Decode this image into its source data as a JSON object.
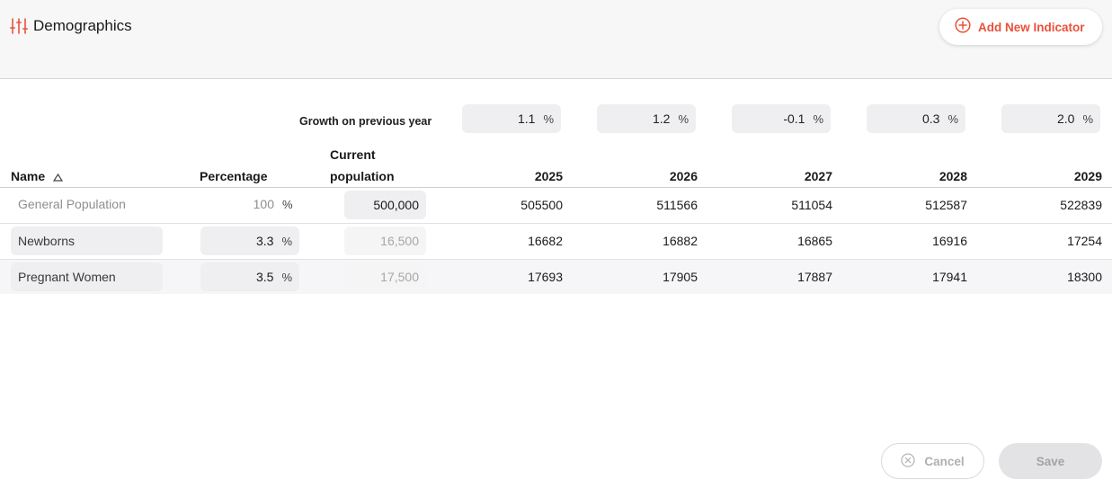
{
  "header": {
    "title": "Demographics",
    "title_icon": "sliders-icon",
    "add_button_label": "Add New Indicator",
    "add_button_icon": "plus-circle-icon",
    "accent_color": "#e8523a"
  },
  "growth": {
    "label": "Growth on previous year",
    "unit": "%",
    "values": [
      "1.1",
      "1.2",
      "-0.1",
      "0.3",
      "2.0"
    ]
  },
  "table": {
    "headers": {
      "name": "Name",
      "percentage": "Percentage",
      "current_population_line1": "Current",
      "current_population_line2": "population",
      "years": [
        "2025",
        "2026",
        "2027",
        "2028",
        "2029"
      ]
    },
    "sort_icon": "sort-ascending-icon",
    "pct_unit": "%",
    "rows": [
      {
        "name": "General Population",
        "percentage": "100",
        "current_population": "500,000",
        "values": [
          "505500",
          "511566",
          "511054",
          "512587",
          "522839"
        ]
      },
      {
        "name": "Newborns",
        "percentage": "3.3",
        "current_population": "16,500",
        "values": [
          "16682",
          "16882",
          "16865",
          "16916",
          "17254"
        ]
      },
      {
        "name": "Pregnant Women",
        "percentage": "3.5",
        "current_population": "17,500",
        "values": [
          "17693",
          "17905",
          "17887",
          "17941",
          "18300"
        ]
      }
    ]
  },
  "footer": {
    "cancel_label": "Cancel",
    "cancel_icon": "x-circle-icon",
    "save_label": "Save"
  }
}
